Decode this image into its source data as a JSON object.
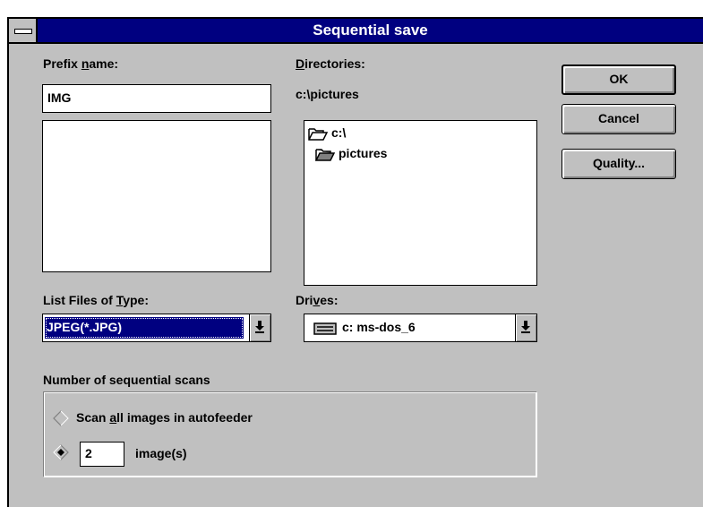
{
  "dialog": {
    "title": "Sequential save"
  },
  "prefix": {
    "label_before": "Prefix ",
    "label_accel": "n",
    "label_after": "ame:",
    "value": "IMG"
  },
  "directories": {
    "label_accel": "D",
    "label_after": "irectories:",
    "current_path": "c:\\pictures",
    "items": [
      "c:\\",
      "pictures"
    ]
  },
  "file_type": {
    "label_before": "List Files of ",
    "label_accel": "T",
    "label_after": "ype:",
    "selected": "JPEG(*.JPG)"
  },
  "drives": {
    "label_before": "Dri",
    "label_accel": "v",
    "label_after": "es:",
    "selected": "c: ms-dos_6"
  },
  "buttons": {
    "ok": "OK",
    "cancel": "Cancel",
    "quality": "Quality..."
  },
  "scans": {
    "group_label": "Number of sequential scans",
    "option_all_before": "Scan ",
    "option_all_accel": "a",
    "option_all_after": "ll images in autofeeder",
    "count_value": "2",
    "count_suffix": "image(s)",
    "selected_option": "count"
  }
}
